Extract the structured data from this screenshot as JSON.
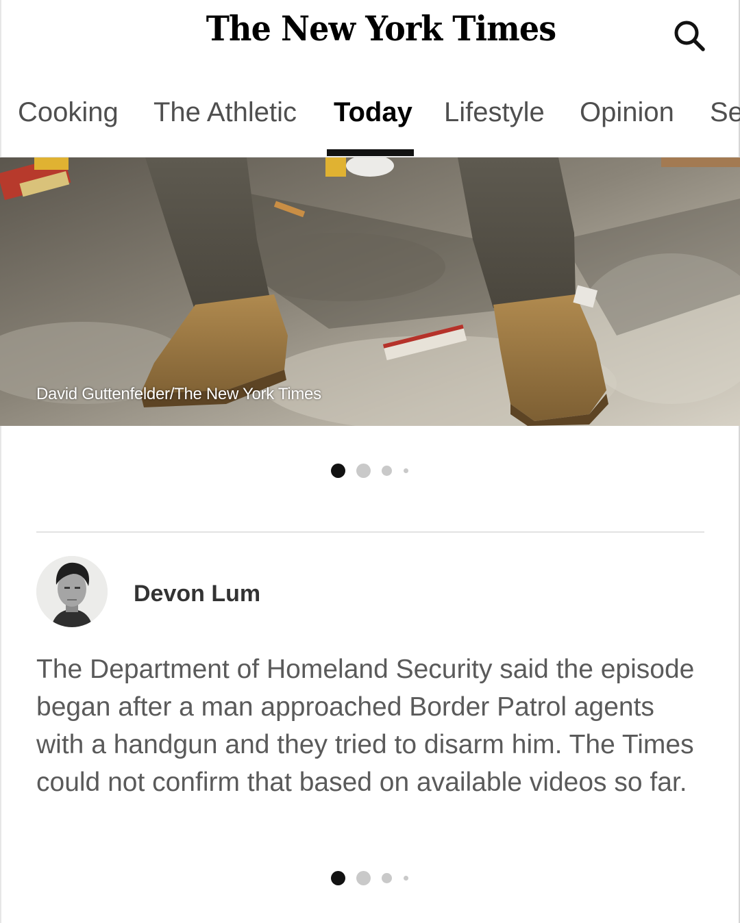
{
  "header": {
    "masthead": "The New York Times",
    "search_icon": "search-icon"
  },
  "tabs": [
    {
      "label": "Cooking",
      "active": false
    },
    {
      "label": "The Athletic",
      "active": false
    },
    {
      "label": "Today",
      "active": true
    },
    {
      "label": "Lifestyle",
      "active": false
    },
    {
      "label": "Opinion",
      "active": false
    },
    {
      "label": "Se",
      "active": false
    }
  ],
  "hero": {
    "credit": "David Guttenfelder/The New York Times"
  },
  "carousel_1": {
    "pages": 4,
    "current": 1
  },
  "post": {
    "author": "Devon Lum",
    "text": "The Department of Homeland Security said the episode began after a man approached Border Patrol agents with a handgun and they tried to disarm him. The Times could not confirm that based on available videos so far."
  },
  "carousel_2": {
    "pages": 4,
    "current": 1
  },
  "colors": {
    "active_dot": "#121212",
    "inactive_dot": "#c9c9c9",
    "body_text": "#5a5a5a"
  }
}
